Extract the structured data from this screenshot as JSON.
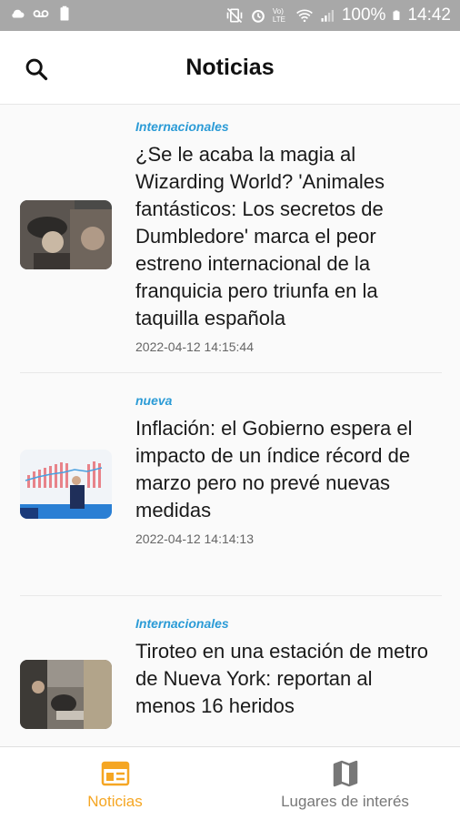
{
  "status_bar": {
    "left_icons": [
      "cloud-icon",
      "voicemail-icon",
      "battery-saver-icon"
    ],
    "right_icons": [
      "vibrate-icon",
      "alarm-icon",
      "volte-icon",
      "wifi-icon",
      "signal-icon",
      "battery-icon"
    ],
    "volte_text": "Vo) LTE",
    "battery_percent": "100%",
    "time": "14:42"
  },
  "app_bar": {
    "title": "Noticias",
    "search_icon": "search-icon"
  },
  "articles": [
    {
      "category": "Internacionales",
      "headline": "¿Se le acaba la magia al Wizarding World? 'Animales fantásticos: Los secretos de Dumbledore' marca el peor estreno internacional de la franquicia pero triunfa en la taquilla española",
      "date": "2022-04-12 14:15:44"
    },
    {
      "category": "nueva",
      "headline": "Inflación: el Gobierno espera el impacto de un índice récord de marzo pero no prevé nuevas medidas",
      "date": "2022-04-12 14:14:13"
    },
    {
      "category": "Internacionales",
      "headline": "Tiroteo en una estación de metro de Nueva York: reportan al menos 16 heridos",
      "date": ""
    }
  ],
  "bottom_nav": {
    "items": [
      {
        "label": "Noticias",
        "icon": "newspaper-icon",
        "active": true
      },
      {
        "label": "Lugares de interés",
        "icon": "map-icon",
        "active": false
      }
    ]
  },
  "colors": {
    "accent": "#f5a623",
    "category": "#2b9bd6",
    "status_bar": "#a8a8a8"
  }
}
